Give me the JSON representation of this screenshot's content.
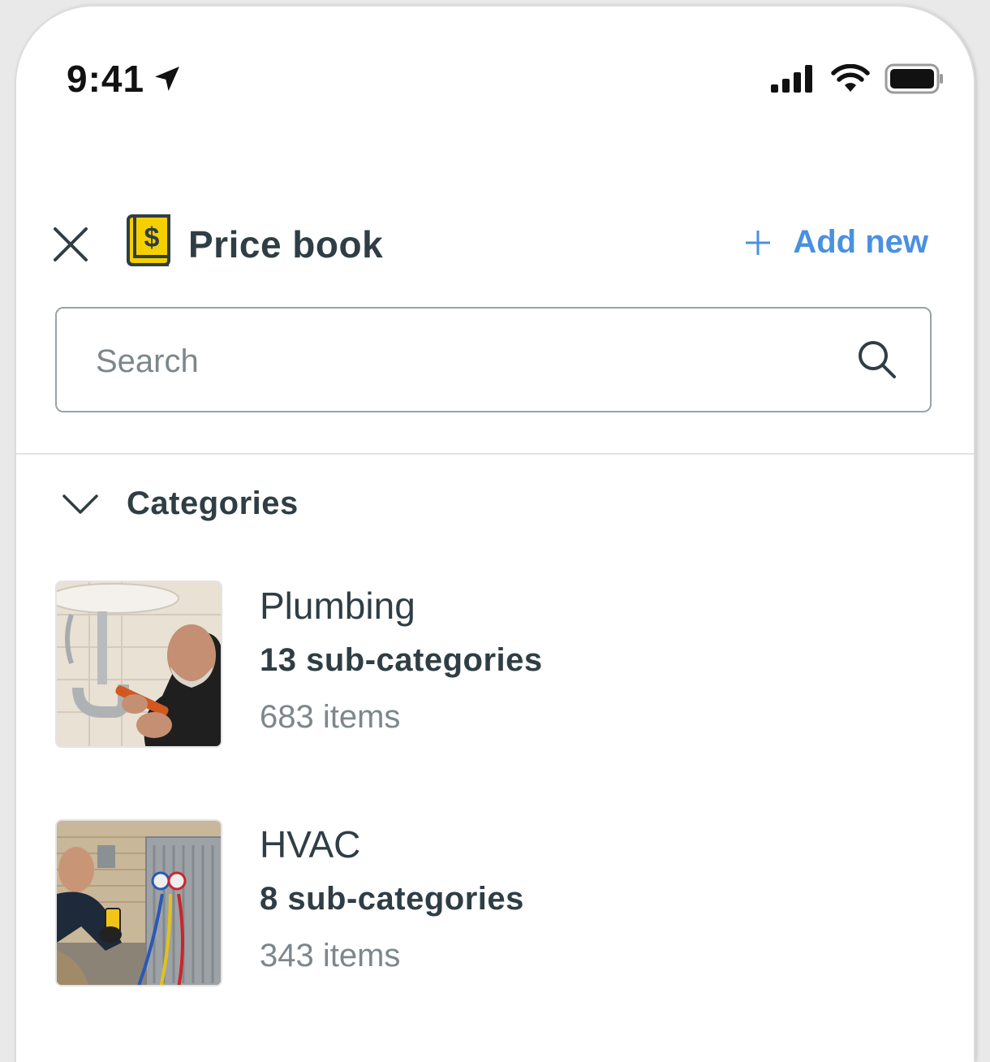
{
  "status_bar": {
    "time": "9:41",
    "icons": [
      "location-arrow-icon",
      "cellular-signal-icon",
      "wifi-icon",
      "battery-icon"
    ]
  },
  "header": {
    "title": "Price book",
    "add_label": "Add new",
    "accent_color": "#4a90e2",
    "icons": [
      "close-icon",
      "price-book-icon",
      "plus-icon"
    ]
  },
  "search": {
    "placeholder": "Search",
    "value": ""
  },
  "categories": {
    "label": "Categories",
    "expanded": true,
    "items": [
      {
        "name": "Plumbing",
        "subcategories": "13 sub-categories",
        "items": "683 items",
        "image": "plumber-photo"
      },
      {
        "name": "HVAC",
        "subcategories": "8 sub-categories",
        "items": "343 items",
        "image": "hvac-technician-photo"
      }
    ]
  }
}
